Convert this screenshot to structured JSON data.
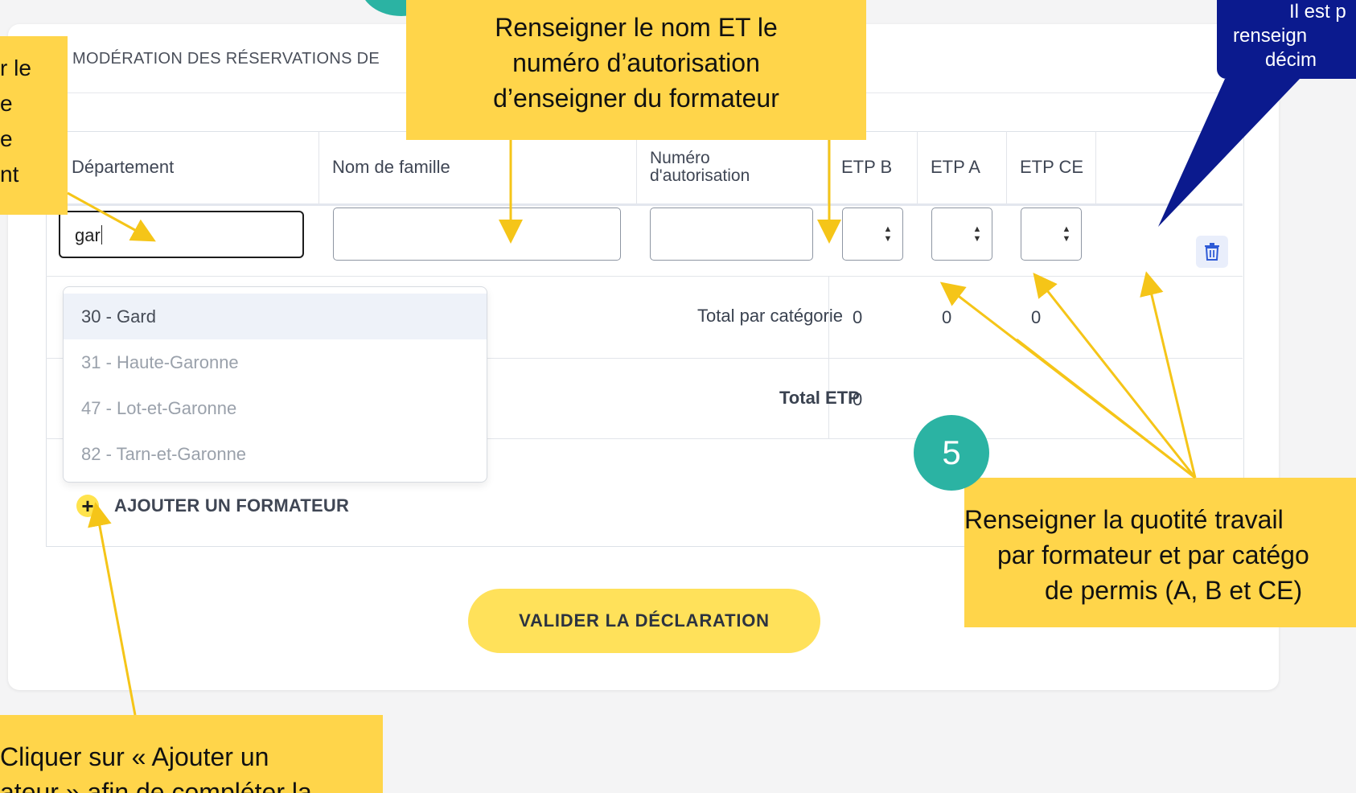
{
  "section_title": "MODÉRATION DES RÉSERVATIONS DE",
  "columns": [
    "Département",
    "Nom de famille",
    "Numéro\nd'autorisation",
    "ETP B",
    "ETP A",
    "ETP CE"
  ],
  "columns_lines": {
    "num1": "Numéro",
    "num2": "d'autorisation"
  },
  "form_row": {
    "department_value": "gar",
    "nom_value": "",
    "numero_value": ""
  },
  "dropdown_options": [
    "30 - Gard",
    "31 - Haute-Garonne",
    "47 - Lot-et-Garonne",
    "82 - Tarn-et-Garonne"
  ],
  "totals": {
    "category_label": "Total par catégorie",
    "category_values": [
      "0",
      "0",
      "0"
    ],
    "etp_label": "Total ETP",
    "etp_value": "0"
  },
  "add_trainer_label": "AJOUTER UN FORMATEUR",
  "validate_label": "VALIDER LA DÉCLARATION",
  "annotations": {
    "top_callout": [
      "Renseigner le nom ET le",
      "numéro d’autorisation",
      "d’enseigner du formateur"
    ],
    "left_callout": [
      "r le",
      "e",
      "e",
      "nt"
    ],
    "right_callout": [
      "Renseigner la quotité travail",
      "par formateur et par catégo",
      "de permis (A, B et CE)"
    ],
    "bottom_callout": [
      "Cliquer sur « Ajouter un",
      "ateur » afin de compléter la"
    ],
    "blue_note": [
      "Il est p",
      "renseign",
      "décim"
    ],
    "badge_number": "5"
  },
  "colors": {
    "callout": "#ffd54a",
    "arrow": "#f5c518",
    "badge": "#2bb3a3",
    "blue_note": "#0b1a8e",
    "button": "#ffe15a"
  },
  "icons": [
    "trash-icon",
    "plus-icon",
    "spin-icon"
  ]
}
